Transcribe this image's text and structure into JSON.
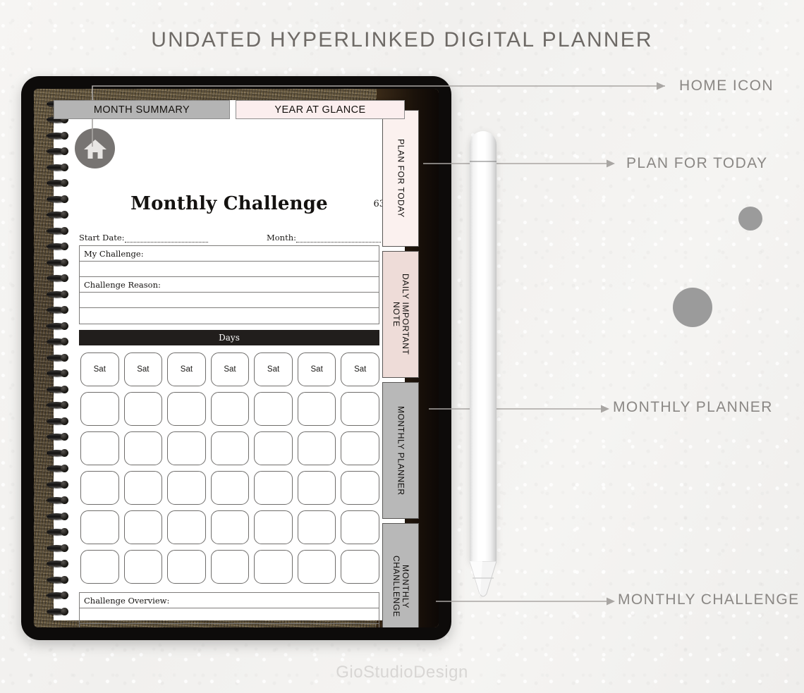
{
  "headline": "UNDATED HYPERLINKED DIGITAL PLANNER",
  "watermark": "GioStudioDesign",
  "colors": {
    "background": "#f4f3f1",
    "headline_text": "#6e6a66",
    "annotation_text": "#8a8784",
    "tablet_frame": "#0d0b0a",
    "tab_active_gray": "#b4b4b4",
    "tab_pink_light": "#fbeeee",
    "tab_pink": "#eedcd8",
    "tab_gray": "#b8b8b8",
    "days_bar": "#211e1c",
    "home_icon_circle": "#777472",
    "decorative_dot": "#9b9b9b",
    "cover_leather": "#6b5a3f"
  },
  "top_tabs": [
    {
      "label": "MONTH SUMMARY",
      "state": "active"
    },
    {
      "label": "YEAR AT GLANCE",
      "state": "inactive"
    }
  ],
  "side_tabs": [
    {
      "label": "PLAN FOR TODAY",
      "color": "#fbf1ef"
    },
    {
      "label": "DAILY IMPORTANT\nNOTE",
      "color": "#eedcd8"
    },
    {
      "label": "MONTHLY PLANNER",
      "color": "#b8b8b8"
    },
    {
      "label": "MONTHLY\nCHANLLENGE",
      "color": "#b8b8b8"
    }
  ],
  "page": {
    "home_icon": "home-icon",
    "title": "Monthly Challenge",
    "page_number": "63",
    "meta": {
      "start_date_label": "Start Date:",
      "start_date_value": "",
      "month_label": "Month:",
      "month_value": ""
    },
    "form_lines": [
      "My Challenge:",
      "",
      "Challenge Reason:",
      "",
      ""
    ],
    "days_bar_label": "Days",
    "day_headers": [
      "Sat",
      "Sat",
      "Sat",
      "Sat",
      "Sat",
      "Sat",
      "Sat"
    ],
    "grid_rows": 5,
    "grid_columns": 7,
    "grid_cells": [
      [
        "",
        "",
        "",
        "",
        "",
        "",
        ""
      ],
      [
        "",
        "",
        "",
        "",
        "",
        "",
        ""
      ],
      [
        "",
        "",
        "",
        "",
        "",
        "",
        ""
      ],
      [
        "",
        "",
        "",
        "",
        "",
        "",
        ""
      ],
      [
        "",
        "",
        "",
        "",
        "",
        "",
        ""
      ]
    ],
    "overview_lines": [
      "Challenge Overview:",
      "",
      ""
    ]
  },
  "annotations": [
    {
      "label": "HOME ICON",
      "target": "home-icon"
    },
    {
      "label": "PLAN FOR TODAY",
      "target": "plan-for-today-tab"
    },
    {
      "label": "MONTHLY PLANNER",
      "target": "monthly-planner-tab"
    },
    {
      "label": "MONTHLY CHALLENGE",
      "target": "monthly-challenge-tab"
    }
  ],
  "stylus": {
    "name": "apple-pencil"
  }
}
